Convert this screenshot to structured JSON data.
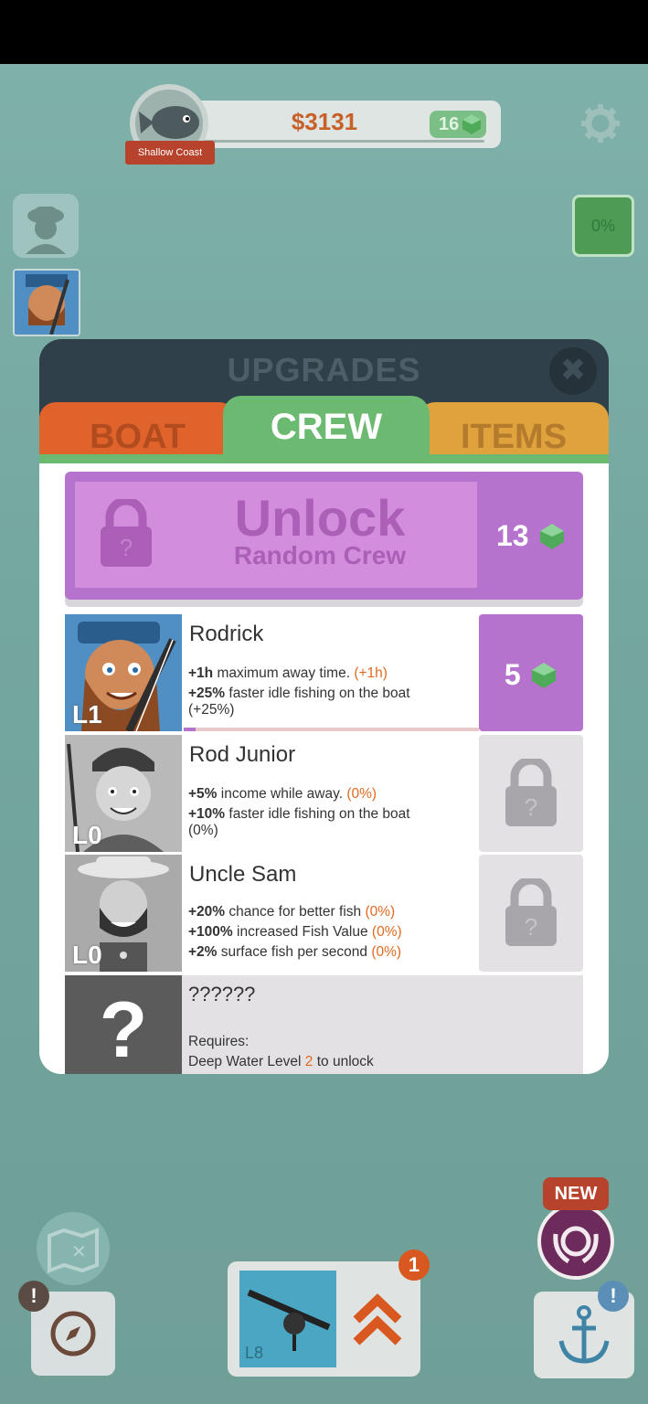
{
  "hud": {
    "money": "$3131",
    "gems": "16",
    "location": "Shallow Coast",
    "progress_percent_label": "0%"
  },
  "upgrades": {
    "title": "UPGRADES",
    "tabs": [
      "BOAT",
      "CREW",
      "ITEMS"
    ],
    "active_tab": "CREW",
    "unlock": {
      "title": "Unlock",
      "subtitle": "Random Crew",
      "price": "13"
    },
    "crew": [
      {
        "name": "Rodrick",
        "level": "L1",
        "stat1_bold": "+1h",
        "stat1_text": " maximum away time. ",
        "stat1_delta": "(+1h)",
        "stat2_bold": "+25%",
        "stat2_text": " faster idle fishing on the boat",
        "stat2_delta": "(+25%)",
        "price": "5",
        "progress": 0.04
      },
      {
        "name": "Rod Junior",
        "level": "L0",
        "stat1_bold": "+5%",
        "stat1_text": " income while away. ",
        "stat1_delta": "(0%)",
        "stat2_bold": "+10%",
        "stat2_text": " faster idle fishing on the boat",
        "stat2_delta": "(0%)"
      },
      {
        "name": "Uncle Sam",
        "level": "L0",
        "stat1_bold": "+20%",
        "stat1_text": " chance for better fish ",
        "stat1_delta": "(0%)",
        "stat2_bold": "+100%",
        "stat2_text": " increased Fish Value ",
        "stat2_delta": "(0%)",
        "stat3_bold": "+2%",
        "stat3_text": " surface fish per second ",
        "stat3_delta": "(0%)"
      }
    ],
    "mystery": {
      "name": "??????",
      "requires_label": "Requires:",
      "req_prefix": "Deep Water Level ",
      "req_level": "2",
      "req_suffix": " to unlock"
    }
  },
  "bottom": {
    "rod_level": "L8",
    "upgrade_badge": "1",
    "new_badge": "NEW",
    "alert_mark": "!"
  },
  "colors": {
    "sea": "#75a8a1",
    "crew_tab": "#6cba72",
    "boat_tab": "#e0632c",
    "items_tab": "#e0a23d",
    "purple": "#b673cd",
    "accent_orange": "#e06a21"
  }
}
